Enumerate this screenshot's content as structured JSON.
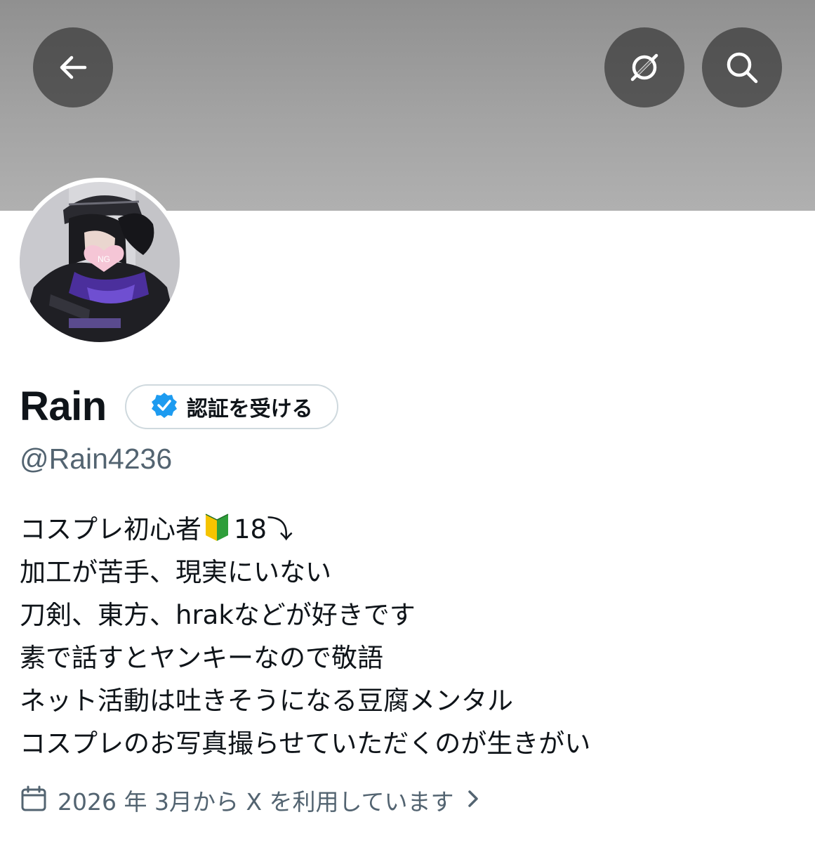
{
  "header": {
    "back_icon": "arrow-left-icon",
    "grok_icon": "grok-icon",
    "search_icon": "search-icon"
  },
  "profile": {
    "display_name": "Rain",
    "verify_button_label": "認証を受ける",
    "handle": "@Rain4236",
    "avatar_sticker_text": "NG",
    "bio_lines": [
      "コスプレ初心者",
      "18⤵︎",
      "加工が苦手、現実にいない",
      "刀剣、東方、hrakなどが好きです",
      "素で話すとヤンキーなので敬語",
      "ネット活動は吐きそうになる豆腐メンタル",
      "コスプレのお写真撮らせていただくのが生きがい"
    ],
    "joined_text": "2026 年 3月から X を利用しています"
  },
  "colors": {
    "banner": "#a0a0a0",
    "text_primary": "#0f1419",
    "text_secondary": "#536471",
    "verified_blue": "#1d9bf0",
    "border": "#cfd9de"
  }
}
